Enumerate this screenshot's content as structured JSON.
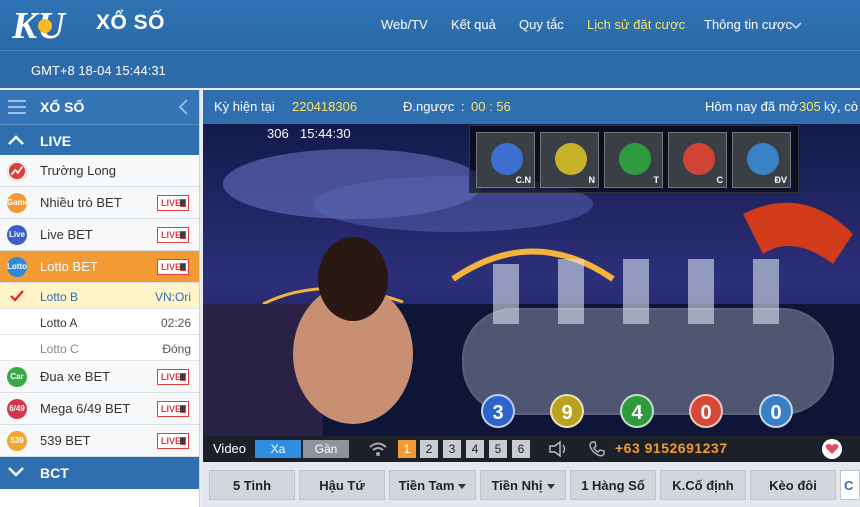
{
  "header": {
    "logo_text": "KU",
    "brand": "XỔ SỐ",
    "nav": [
      "Web/TV",
      "Kết quả",
      "Quy tắc",
      "Lịch sử đặt cược",
      "Thông tin cược"
    ],
    "clock": "GMT+8 18-04 15:44:31"
  },
  "sidebar": {
    "title": "XỔ SỐ",
    "live_section": "LIVE",
    "live_tag": "LIVE",
    "items": [
      {
        "label": "Trường Long",
        "badge": ""
      },
      {
        "label": "Nhiều trò BET",
        "badge": "Game"
      },
      {
        "label": "Live BET",
        "badge": "Live"
      },
      {
        "label": "Lotto BET",
        "badge": "Lotto"
      }
    ],
    "sub_items": [
      {
        "label": "Lotto B",
        "status": "VN:Ori"
      },
      {
        "label": "Lotto A",
        "status": "02:26"
      },
      {
        "label": "Lotto C",
        "status": "Đóng"
      }
    ],
    "items2": [
      {
        "label": "Đua xe BET",
        "badge": "Car"
      },
      {
        "label": "Mega 6/49 BET",
        "badge": "6/49"
      },
      {
        "label": "539 BET",
        "badge": "539"
      }
    ],
    "bct_section": "BCT",
    "colors": {
      "accent": "#f29a33",
      "header": "#2f6fb0"
    }
  },
  "info": {
    "period_label": "Kỳ hiện tại",
    "period_value": "220418306",
    "countdown_label": "Đ.ngược",
    "countdown_value": "00 : 56",
    "today_prefix": "Hôm nay đã mở",
    "today_count": "305",
    "today_suffix": "kỳ, cò"
  },
  "video": {
    "period_short": "306",
    "time": "15:44:30",
    "cams": [
      "C.N",
      "N",
      "T",
      "C",
      "ĐV"
    ],
    "balls": [
      "3",
      "9",
      "4",
      "0",
      "0"
    ],
    "ball_colors": [
      "#2f63c9",
      "#b9a21e",
      "#2e9a3c",
      "#d4493a",
      "#3a7fc4"
    ]
  },
  "controls": {
    "video_label": "Video",
    "far": "Xa",
    "near": "Gần",
    "streams": [
      "1",
      "2",
      "3",
      "4",
      "5",
      "6"
    ],
    "active_stream": "1",
    "phone": "+63 9152691237"
  },
  "tabs": [
    "5 Tinh",
    "Hậu Tứ",
    "Tiền Tam",
    "Tiền Nhị",
    "1 Hàng Số",
    "K.Cố định",
    "Kèo đôi",
    "C"
  ]
}
